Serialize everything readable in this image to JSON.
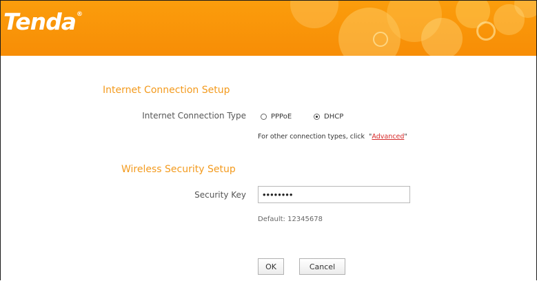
{
  "brand": {
    "logo_text": "Tenda",
    "registered_mark": "®"
  },
  "internet": {
    "section_title": "Internet Connection Setup",
    "type_label": "Internet Connection Type",
    "options": [
      {
        "label": "PPPoE",
        "checked": false
      },
      {
        "label": "DHCP",
        "checked": true
      }
    ],
    "hint_prefix": "For other connection types, click",
    "hint_quote_open": "\"",
    "advanced_link": "Advanced",
    "hint_quote_close": "\""
  },
  "wireless": {
    "section_title": "Wireless Security Setup",
    "key_label": "Security Key",
    "key_value": "••••••••",
    "default_text": "Default: 12345678"
  },
  "buttons": {
    "ok": "OK",
    "cancel": "Cancel"
  },
  "colors": {
    "banner": "#f78d06",
    "section_title": "#f39a1d",
    "link": "#d62a2a"
  }
}
